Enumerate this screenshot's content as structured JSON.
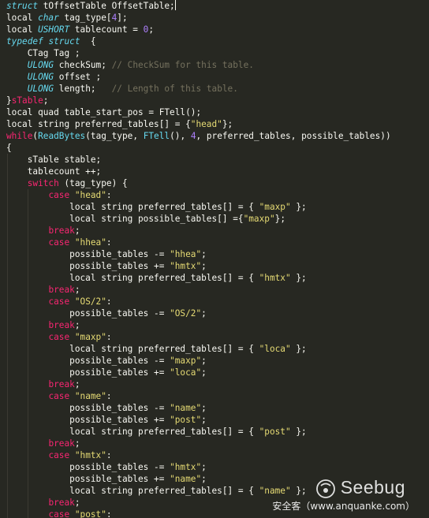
{
  "editor": {
    "theme_colors": {
      "background": "#272822",
      "keyword": "#f92672",
      "type": "#66d9ef",
      "string": "#e6db74",
      "number": "#ae81ff",
      "comment": "#75715e",
      "text": "#f8f8f2"
    },
    "lines": [
      [
        [
          "kwi",
          "struct"
        ],
        [
          "pl",
          " tOffsetTable OffsetTable;"
        ],
        [
          "cursor",
          ""
        ]
      ],
      [
        [
          "pl",
          "local "
        ],
        [
          "ty",
          "char"
        ],
        [
          "pl",
          " tag_type["
        ],
        [
          "num",
          "4"
        ],
        [
          "pl",
          "];"
        ]
      ],
      [
        [
          "pl",
          "local "
        ],
        [
          "ty",
          "USHORT"
        ],
        [
          "pl",
          " tablecount = "
        ],
        [
          "num",
          "0"
        ],
        [
          "pl",
          ";"
        ]
      ],
      [
        [
          "kwi",
          "typedef"
        ],
        [
          "pl",
          " "
        ],
        [
          "kwi",
          "struct"
        ],
        [
          "pl",
          "  {"
        ]
      ],
      [
        [
          "pl",
          "    CTag Tag ;"
        ]
      ],
      [
        [
          "pl",
          "    "
        ],
        [
          "ty",
          "ULONG"
        ],
        [
          "pl",
          " checkSum; "
        ],
        [
          "cmt",
          "// CheckSum for this table."
        ]
      ],
      [
        [
          "pl",
          "    "
        ],
        [
          "ty",
          "ULONG"
        ],
        [
          "pl",
          " offset ;"
        ]
      ],
      [
        [
          "pl",
          "    "
        ],
        [
          "ty",
          "ULONG"
        ],
        [
          "pl",
          " length;   "
        ],
        [
          "cmt",
          "// Length of this table."
        ]
      ],
      [
        [
          "pl",
          "}"
        ],
        [
          "kw",
          "sTable"
        ],
        [
          "pl",
          ";"
        ]
      ],
      [
        [
          "pl",
          "local quad table_start_pos = FTell();"
        ]
      ],
      [
        [
          "pl",
          "local string preferred_tables[] = {"
        ],
        [
          "str",
          "\"head\""
        ],
        [
          "pl",
          "};"
        ]
      ],
      [
        [
          "kw",
          "while"
        ],
        [
          "pl",
          "("
        ],
        [
          "fn",
          "ReadBytes"
        ],
        [
          "pl",
          "(tag_type, "
        ],
        [
          "fn",
          "FTell"
        ],
        [
          "pl",
          "(), "
        ],
        [
          "num",
          "4"
        ],
        [
          "pl",
          ", preferred_tables, possible_tables))"
        ]
      ],
      [
        [
          "pl",
          "{"
        ]
      ],
      [
        [
          "pl",
          "    sTable stable;"
        ]
      ],
      [
        [
          "pl",
          "    tablecount ++;"
        ]
      ],
      [
        [
          "pl",
          "    "
        ],
        [
          "kw",
          "switch"
        ],
        [
          "pl",
          " (tag_type) {"
        ]
      ],
      [
        [
          "pl",
          "        "
        ],
        [
          "kw",
          "case"
        ],
        [
          "pl",
          " "
        ],
        [
          "str",
          "\"head\""
        ],
        [
          "pl",
          ":"
        ]
      ],
      [
        [
          "pl",
          "            local string preferred_tables[] = { "
        ],
        [
          "str",
          "\"maxp\""
        ],
        [
          "pl",
          " };"
        ]
      ],
      [
        [
          "pl",
          "            local string possible_tables[] ={"
        ],
        [
          "str",
          "\"maxp\""
        ],
        [
          "pl",
          "};"
        ]
      ],
      [
        [
          "pl",
          "        "
        ],
        [
          "kw",
          "break"
        ],
        [
          "pl",
          ";"
        ]
      ],
      [
        [
          "pl",
          "        "
        ],
        [
          "kw",
          "case"
        ],
        [
          "pl",
          " "
        ],
        [
          "str",
          "\"hhea\""
        ],
        [
          "pl",
          ":"
        ]
      ],
      [
        [
          "pl",
          "            possible_tables -= "
        ],
        [
          "str",
          "\"hhea\""
        ],
        [
          "pl",
          ";"
        ]
      ],
      [
        [
          "pl",
          "            possible_tables += "
        ],
        [
          "str",
          "\"hmtx\""
        ],
        [
          "pl",
          ";"
        ]
      ],
      [
        [
          "pl",
          "            local string preferred_tables[] = { "
        ],
        [
          "str",
          "\"hmtx\""
        ],
        [
          "pl",
          " };"
        ]
      ],
      [
        [
          "pl",
          "        "
        ],
        [
          "kw",
          "break"
        ],
        [
          "pl",
          ";"
        ]
      ],
      [
        [
          "pl",
          "        "
        ],
        [
          "kw",
          "case"
        ],
        [
          "pl",
          " "
        ],
        [
          "str",
          "\"OS/2\""
        ],
        [
          "pl",
          ":"
        ]
      ],
      [
        [
          "pl",
          "            possible_tables -= "
        ],
        [
          "str",
          "\"OS/2\""
        ],
        [
          "pl",
          ";"
        ]
      ],
      [
        [
          "pl",
          "        "
        ],
        [
          "kw",
          "break"
        ],
        [
          "pl",
          ";"
        ]
      ],
      [
        [
          "pl",
          "        "
        ],
        [
          "kw",
          "case"
        ],
        [
          "pl",
          " "
        ],
        [
          "str",
          "\"maxp\""
        ],
        [
          "pl",
          ":"
        ]
      ],
      [
        [
          "pl",
          "            local string preferred_tables[] = { "
        ],
        [
          "str",
          "\"loca\""
        ],
        [
          "pl",
          " };"
        ]
      ],
      [
        [
          "pl",
          "            possible_tables -= "
        ],
        [
          "str",
          "\"maxp\""
        ],
        [
          "pl",
          ";"
        ]
      ],
      [
        [
          "pl",
          "            possible_tables += "
        ],
        [
          "str",
          "\"loca\""
        ],
        [
          "pl",
          ";"
        ]
      ],
      [
        [
          "pl",
          "        "
        ],
        [
          "kw",
          "break"
        ],
        [
          "pl",
          ";"
        ]
      ],
      [
        [
          "pl",
          "        "
        ],
        [
          "kw",
          "case"
        ],
        [
          "pl",
          " "
        ],
        [
          "str",
          "\"name\""
        ],
        [
          "pl",
          ":"
        ]
      ],
      [
        [
          "pl",
          "            possible_tables -= "
        ],
        [
          "str",
          "\"name\""
        ],
        [
          "pl",
          ";"
        ]
      ],
      [
        [
          "pl",
          "            possible_tables += "
        ],
        [
          "str",
          "\"post\""
        ],
        [
          "pl",
          ";"
        ]
      ],
      [
        [
          "pl",
          "            local string preferred_tables[] = { "
        ],
        [
          "str",
          "\"post\""
        ],
        [
          "pl",
          " };"
        ]
      ],
      [
        [
          "pl",
          "        "
        ],
        [
          "kw",
          "break"
        ],
        [
          "pl",
          ";"
        ]
      ],
      [
        [
          "pl",
          "        "
        ],
        [
          "kw",
          "case"
        ],
        [
          "pl",
          " "
        ],
        [
          "str",
          "\"hmtx\""
        ],
        [
          "pl",
          ":"
        ]
      ],
      [
        [
          "pl",
          "            possible_tables -= "
        ],
        [
          "str",
          "\"hmtx\""
        ],
        [
          "pl",
          ";"
        ]
      ],
      [
        [
          "pl",
          "            possible_tables += "
        ],
        [
          "str",
          "\"name\""
        ],
        [
          "pl",
          ";"
        ]
      ],
      [
        [
          "pl",
          "            local string preferred_tables[] = { "
        ],
        [
          "str",
          "\"name\""
        ],
        [
          "pl",
          " };"
        ]
      ],
      [
        [
          "pl",
          "        "
        ],
        [
          "kw",
          "break"
        ],
        [
          "pl",
          ";"
        ]
      ],
      [
        [
          "pl",
          "        "
        ],
        [
          "kw",
          "case"
        ],
        [
          "pl",
          " "
        ],
        [
          "str",
          "\"post\""
        ],
        [
          "pl",
          ":"
        ]
      ]
    ]
  },
  "watermark": {
    "logo_text": "Seebug",
    "subtitle": "安全客（www.anquanke.com）",
    "icon": "seebug-bug-icon"
  }
}
